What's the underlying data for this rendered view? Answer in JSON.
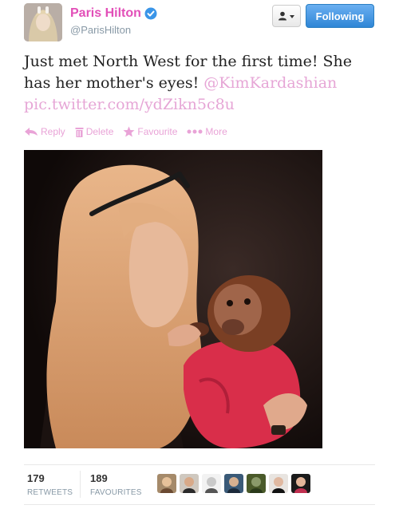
{
  "author": {
    "display_name": "Paris Hilton",
    "handle": "@ParisHilton",
    "verified": true,
    "avatar_icon": "profile-avatar"
  },
  "header_actions": {
    "user_menu_icon": "user-dropdown-icon",
    "follow_label": "Following"
  },
  "tweet": {
    "text_part1": "Just met North West for the first time! She has her mother's eyes! ",
    "mention": "@KimKardashian",
    "pic_link": "pic.twitter.com/ydZikn5c8u"
  },
  "actions": {
    "reply_label": "Reply",
    "delete_label": "Delete",
    "favourite_label": "Favourite",
    "more_label": "More"
  },
  "stats": {
    "retweets_count": "179",
    "retweets_label": "RETWEETS",
    "favourites_count": "189",
    "favourites_label": "FAVOURITES"
  },
  "colors": {
    "name": "#e24fb8",
    "link": "#e6a6d6",
    "action": "#e9a3d7",
    "follow_button": "#2f86d6"
  }
}
